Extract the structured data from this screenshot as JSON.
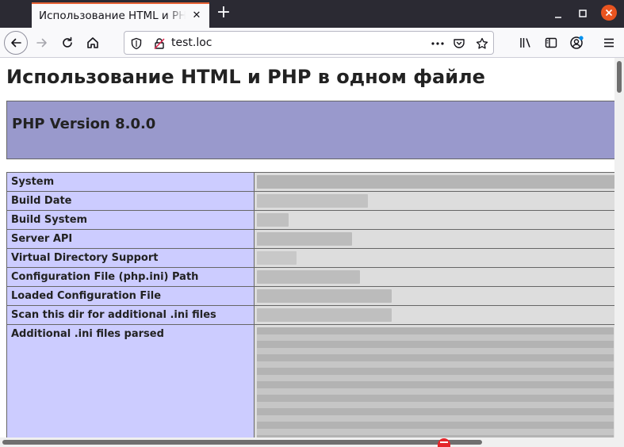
{
  "browser": {
    "tab_title": "Использование HTML и PHP в одном файле",
    "tab_close_glyph": "✕",
    "new_tab_glyph": "+",
    "url": "test.loc",
    "accent": "#e66235",
    "window_close_color": "#e95420"
  },
  "icons": {
    "back": "back-arrow-icon",
    "forward": "forward-arrow-icon",
    "reload": "reload-icon",
    "home": "home-icon",
    "shield": "tracking-shield-icon",
    "insecure": "insecure-lock-icon",
    "page_actions": "more-actions-icon",
    "pocket": "pocket-icon",
    "bookmark": "bookmark-star-icon",
    "library": "library-icon",
    "sidebar": "sidebar-icon",
    "account": "account-icon",
    "menu": "hamburger-menu-icon"
  },
  "page": {
    "heading": "Использование HTML и PHP в одном файле",
    "php_version": "PHP Version 8.0.0",
    "header_color": "#9999cc",
    "label_color": "#ccccff",
    "rows": [
      {
        "label": "System"
      },
      {
        "label": "Build Date"
      },
      {
        "label": "Build System"
      },
      {
        "label": "Server API"
      },
      {
        "label": "Virtual Directory Support"
      },
      {
        "label": "Configuration File (php.ini) Path"
      },
      {
        "label": "Loaded Configuration File"
      },
      {
        "label": "Scan this dir for additional .ini files"
      },
      {
        "label": "Additional .ini files parsed"
      }
    ]
  }
}
